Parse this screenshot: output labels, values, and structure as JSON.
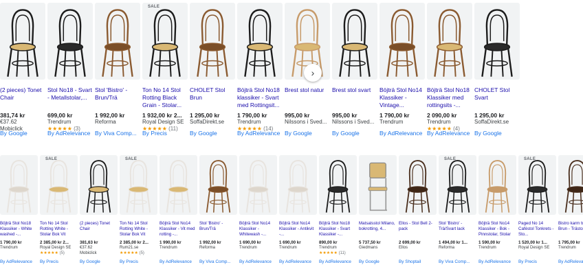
{
  "colors": {
    "title_link": "#1a0dab",
    "by_link": "#1a73e8",
    "star": "#f29900",
    "thumb_bg": "#f1f3f4"
  },
  "next_button": {
    "icon": "chevron-right-icon",
    "glyph": "›"
  },
  "row1": [
    {
      "title": "(2 pieces) Tonet Chair",
      "price": "381,74 kr",
      "sub": "€37.62",
      "merchant": "Mobiclick",
      "rating": "",
      "by": "By Google",
      "sale": "",
      "chair": {
        "style": "black",
        "seat": "cane"
      }
    },
    {
      "title": "Stol No18 - Svart - Metallstolar,...",
      "price": "699,00 kr",
      "sub": "",
      "merchant": "Trendrum",
      "stars": "★★★★★",
      "rating": "(3)",
      "by": "By AdRelevance",
      "sale": "",
      "chair": {
        "style": "black",
        "seat": "plain"
      }
    },
    {
      "title": "Stol 'Bistro' - Brun/Trä",
      "price": "1 992,00 kr",
      "sub": "",
      "merchant": "Reforma",
      "rating": "",
      "by": "By Viva Comp...",
      "sale": "",
      "chair": {
        "style": "brown",
        "seat": "plain"
      }
    },
    {
      "title": "Ton No 14 Stol Rotting Black Grain - Stolar...",
      "price": "1 932,00 kr 2...",
      "sub": "",
      "merchant": "Royal Design SE",
      "stars": "★★★★★",
      "rating": "(11)",
      "by": "By Precis",
      "sale": "SALE",
      "chair": {
        "style": "black",
        "seat": "cane"
      }
    },
    {
      "title": "CHOLET Stol Brun",
      "price": "1 295,00 kr",
      "sub": "",
      "merchant": "SoffaDirekt.se",
      "rating": "",
      "by": "By Google",
      "sale": "",
      "chair": {
        "style": "brown",
        "seat": "plain"
      }
    },
    {
      "title": "Böjträ Stol No18 klassiker - Svart med Rottingsit...",
      "price": "1 790,00 kr",
      "sub": "",
      "merchant": "Trendrum",
      "stars": "★★★★★",
      "rating": "(14)",
      "by": "By AdRelevance",
      "sale": "",
      "chair": {
        "style": "black",
        "seat": "cane"
      }
    },
    {
      "title": "Brest stol natur",
      "price": "995,00 kr",
      "sub": "",
      "merchant": "Nilssons i Sved...",
      "rating": "",
      "by": "By Google",
      "sale": "",
      "chair": {
        "style": "natural",
        "seat": "cane"
      }
    },
    {
      "title": "Brest stol svart",
      "price": "995,00 kr",
      "sub": "",
      "merchant": "Nilssons i Sved...",
      "rating": "",
      "by": "By Google",
      "sale": "",
      "chair": {
        "style": "black",
        "seat": "cane"
      }
    },
    {
      "title": "Böjträ Stol No14 Klassiker - Vintage...",
      "price": "1 790,00 kr",
      "sub": "",
      "merchant": "Trendrum",
      "rating": "",
      "by": "By AdRelevance",
      "sale": "",
      "chair": {
        "style": "brown",
        "seat": "plain"
      }
    },
    {
      "title": "Böjträ Stol No18 Klassiker med rottingsits -...",
      "price": "2 090,00 kr",
      "sub": "",
      "merchant": "Trendrum",
      "stars": "★★★★★",
      "rating": "(4)",
      "by": "By AdRelevance",
      "sale": "",
      "chair": {
        "style": "brown",
        "seat": "cane"
      }
    },
    {
      "title": "CHOLET Stol Svart",
      "price": "1 295,00 kr",
      "sub": "",
      "merchant": "SoffaDirekt.se",
      "rating": "",
      "by": "By Google",
      "sale": "",
      "chair": {
        "style": "black",
        "seat": "plain"
      }
    }
  ],
  "row2": [
    {
      "title": "Böjträ Stol No18 Klassiker - White washed -...",
      "price": "1 790,00 kr",
      "sub": "",
      "merchant": "Trendrum",
      "rating": "",
      "by": "By AdRelevance",
      "sale": "",
      "chair": {
        "style": "white",
        "seat": "plain"
      }
    },
    {
      "title": "Ton No 14 Stol Rotting White - Stolar Bok Vit",
      "price": "2 385,00 kr 2...",
      "sub": "",
      "merchant": "Royal Design SE",
      "stars": "★★★★★",
      "rating": "(5)",
      "by": "By Precis",
      "sale": "SALE",
      "chair": {
        "style": "white",
        "seat": "cane"
      }
    },
    {
      "title": "(2 pieces) Tonet Chair",
      "price": "381,63 kr",
      "sub": "€37.62",
      "merchant": "Mobiclick",
      "rating": "",
      "by": "By Google",
      "sale": "",
      "chair": {
        "style": "black",
        "seat": "cane"
      }
    },
    {
      "title": "Ton No 14 Stol Rotting White - Stolar Bok Vit",
      "price": "2 385,00 kr 2...",
      "sub": "",
      "merchant": "Rum21.se",
      "stars": "★★★★★",
      "rating": "(5)",
      "by": "By Precis",
      "sale": "SALE",
      "chair": {
        "style": "white",
        "seat": "cane"
      }
    },
    {
      "title": "Böjträ Stol No14 Klassiker - Vit med rotting -...",
      "price": "1 990,00 kr",
      "sub": "",
      "merchant": "Trendrum",
      "rating": "",
      "by": "By AdRelevance",
      "sale": "",
      "chair": {
        "style": "white",
        "seat": "cane"
      }
    },
    {
      "title": "Stol 'Bistro' - Brun/Trä",
      "price": "1 992,00 kr",
      "sub": "",
      "merchant": "Reforma",
      "rating": "",
      "by": "By Viva Comp...",
      "sale": "",
      "chair": {
        "style": "brown",
        "seat": "plain"
      }
    },
    {
      "title": "Böjträ Stol No14 Klassiker - Whitewash -...",
      "price": "1 690,00 kr",
      "sub": "",
      "merchant": "Trendrum",
      "rating": "",
      "by": "By AdRelevance",
      "sale": "",
      "chair": {
        "style": "white",
        "seat": "plain"
      }
    },
    {
      "title": "Böjträ Stol No14 Klassiker - Antikvit -...",
      "price": "1 690,00 kr",
      "sub": "",
      "merchant": "Trendrum",
      "rating": "",
      "by": "By AdRelevance",
      "sale": "",
      "chair": {
        "style": "white",
        "seat": "plain"
      }
    },
    {
      "title": "Böjträ Stol No18 Klassiker - Svart Klassiker -...",
      "price": "890,00 kr",
      "sub": "",
      "merchant": "Trendrum",
      "stars": "★★★★★",
      "rating": "(11)",
      "by": "By AdRelevance",
      "sale": "",
      "chair": {
        "style": "black",
        "seat": "plain"
      }
    },
    {
      "title": "Matsalsstol Milano, bokrotting, 4...",
      "price": "5 737,50 kr",
      "sub": "",
      "merchant": "Giedmans",
      "rating": "",
      "by": "By Google",
      "sale": "",
      "chair": {
        "style": "cantilever",
        "seat": "cane"
      }
    },
    {
      "title": "Ellos - Stol Bell 2-pack",
      "price": "2 699,00 kr",
      "sub": "",
      "merchant": "Ellos",
      "rating": "",
      "by": "By Shoptail",
      "sale": "",
      "chair": {
        "style": "darkbrown",
        "seat": "plain"
      }
    },
    {
      "title": "Stol 'Bistro' - Trä/Svart lack",
      "price": "1 494,00 kr 1...",
      "sub": "",
      "merchant": "Reforma",
      "rating": "",
      "by": "By Viva Comp...",
      "sale": "SALE",
      "chair": {
        "style": "black",
        "seat": "plain"
      }
    },
    {
      "title": "Böjträ Stol No14 Klassiker - Bok - Pinnstolar, Stolar",
      "price": "1 590,00 kr",
      "sub": "",
      "merchant": "Trendrum",
      "rating": "",
      "by": "By AdRelevance",
      "sale": "",
      "chair": {
        "style": "natural",
        "seat": "plain"
      }
    },
    {
      "title": "Paged No 14 Caféstol Tonkrets - Sto...",
      "price": "1 520,00 kr 1...",
      "sub": "",
      "merchant": "Royal Design SE",
      "rating": "",
      "by": "By Precis",
      "sale": "SALE",
      "chair": {
        "style": "black",
        "seat": "plain"
      }
    },
    {
      "title": "Bistro karm trästol - Brun - Trästolar,...",
      "price": "1 795,00 kr",
      "sub": "",
      "merchant": "Trendrum",
      "rating": "",
      "by": "By AdRelevance",
      "sale": "",
      "chair": {
        "style": "darkbrown",
        "seat": "plain"
      }
    }
  ]
}
